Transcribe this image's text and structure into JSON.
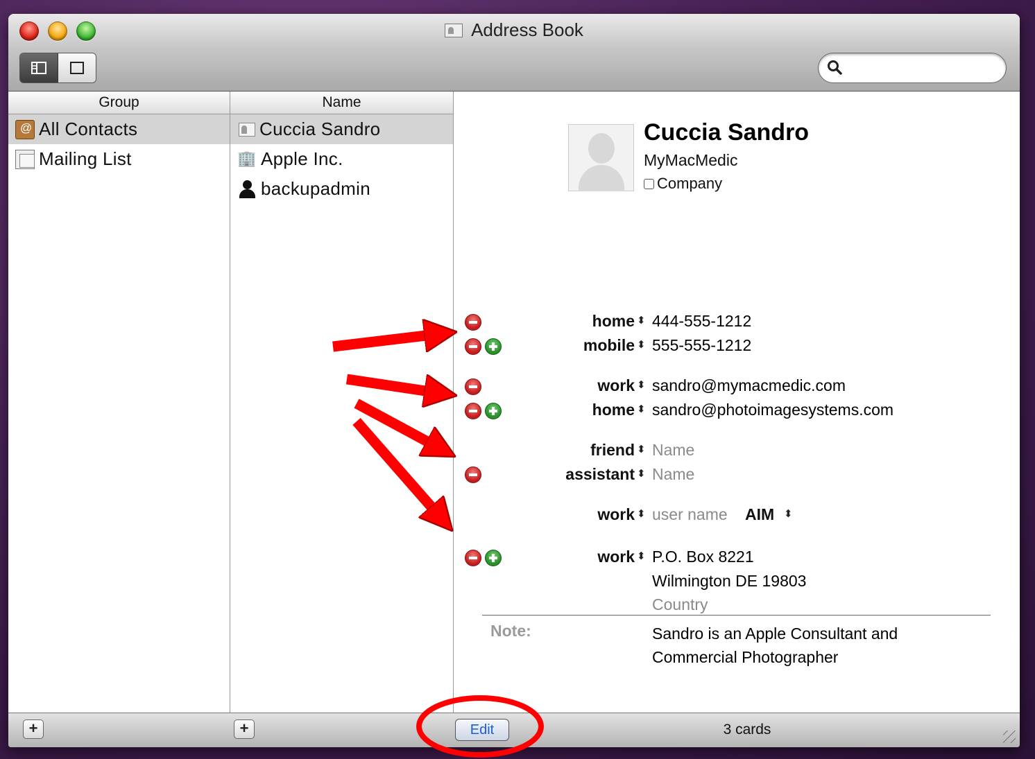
{
  "window": {
    "title": "Address Book"
  },
  "search": {
    "placeholder": "",
    "value": ""
  },
  "columns": {
    "group": "Group",
    "name": "Name"
  },
  "groups": [
    {
      "label": "All Contacts",
      "icon": "contacts-book-icon",
      "selected": true
    },
    {
      "label": "Mailing List",
      "icon": "group-stack-icon",
      "selected": false
    }
  ],
  "names": [
    {
      "label": "Cuccia Sandro",
      "icon": "card-icon",
      "selected": true
    },
    {
      "label": "Apple Inc.",
      "icon": "building-icon",
      "selected": false
    },
    {
      "label": "backupadmin",
      "icon": "person-icon",
      "selected": false
    }
  ],
  "card": {
    "name": "Cuccia Sandro",
    "company": "MyMacMedic",
    "company_checkbox_label": "Company",
    "phones": [
      {
        "label": "home",
        "value": "444-555-1212"
      },
      {
        "label": "mobile",
        "value": "555-555-1212"
      }
    ],
    "emails": [
      {
        "label": "work",
        "value": "sandro@mymacmedic.com"
      },
      {
        "label": "home",
        "value": "sandro@photoimagesystems.com"
      }
    ],
    "related": [
      {
        "label": "friend",
        "value": "Name"
      },
      {
        "label": "assistant",
        "value": "Name"
      }
    ],
    "im": {
      "label": "work",
      "value": "user name",
      "service": "AIM"
    },
    "address": {
      "label": "work",
      "line1": "P.O. Box 8221",
      "line2": "Wilmington DE 19803",
      "country": "Country"
    },
    "note_label": "Note:",
    "note_line1": "Sandro is an Apple Consultant and",
    "note_line2": "Commercial Photographer"
  },
  "bottom": {
    "add_group": "+",
    "add_name": "+",
    "edit": "Edit",
    "count": "3 cards"
  },
  "colors": {
    "annotation": "#ff0000",
    "minus": "#c41d1d",
    "plus": "#2a8f2a",
    "edit_text": "#1c5bd6"
  }
}
